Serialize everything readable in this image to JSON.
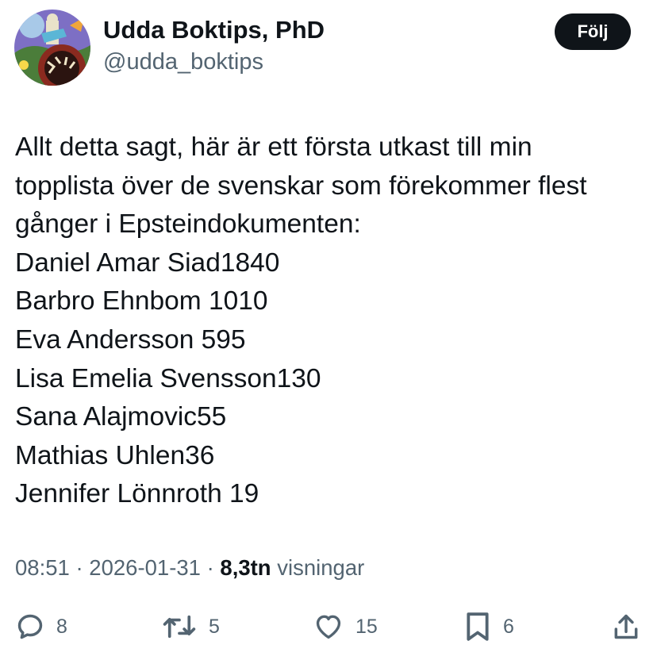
{
  "author": {
    "display_name": "Udda Boktips, PhD",
    "handle": "@udda_boktips"
  },
  "follow_button": {
    "label": "Följ"
  },
  "tweet": {
    "lines": [
      "Allt detta sagt, här är ett första utkast till min",
      "topplista över de svenskar som förekommer flest",
      "gånger i Epsteindokumenten:",
      "Daniel Amar Siad1840",
      "Barbro Ehnbom 1010",
      "Eva Andersson 595",
      "Lisa Emelia Svensson130",
      "Sana Alajmovic55",
      "Mathias Uhlen36",
      "Jennifer Lönnroth 19"
    ]
  },
  "meta": {
    "time": "08:51",
    "sep1": " · ",
    "date": "2026-01-31",
    "sep2": " · ",
    "views_count": "8,3tn",
    "views_label": " visningar"
  },
  "actions": {
    "replies": {
      "icon": "reply-icon",
      "count": "8"
    },
    "retweets": {
      "icon": "retweet-icon",
      "count": "5"
    },
    "likes": {
      "icon": "heart-icon",
      "count": "15"
    },
    "bookmarks": {
      "icon": "bookmark-icon",
      "count": "6"
    },
    "share": {
      "icon": "share-icon"
    }
  },
  "colors": {
    "text_primary": "#0f1419",
    "text_secondary": "#536471",
    "button_bg": "#0f1419",
    "button_text": "#ffffff",
    "background": "#ffffff"
  }
}
